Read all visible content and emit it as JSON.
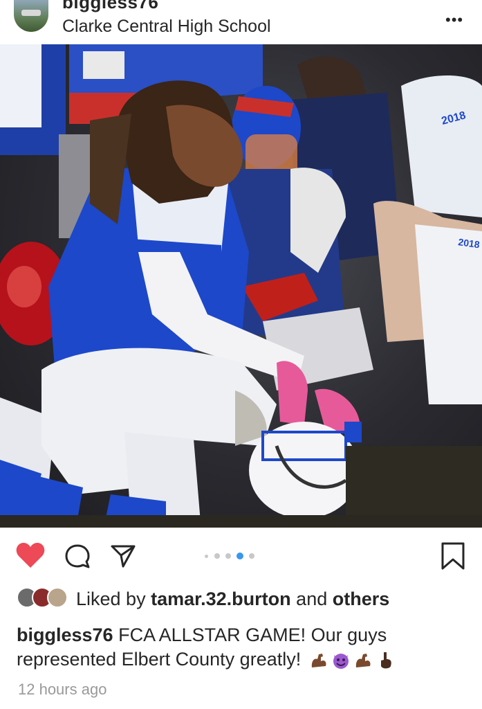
{
  "post": {
    "username": "biggless76",
    "location": "Clarke Central High School"
  },
  "carousel": {
    "count": 5,
    "active_index": 3
  },
  "likes": {
    "prefix": "Liked by",
    "user": "tamar.32.burton",
    "joiner": "and",
    "others": "others"
  },
  "caption": {
    "username": "biggless76",
    "text": "FCA ALLSTAR GAME! Our guys represented Elbert County greatly!",
    "emojis": [
      "flexed-biceps-dark",
      "smiling-devil",
      "flexed-biceps-dark",
      "index-pointing-up-dark"
    ]
  },
  "timestamp": "12 hours ago",
  "photo": {
    "jersey_text": [
      "2018",
      "2018"
    ]
  },
  "colors": {
    "like_red": "#ed4956",
    "text": "#262626",
    "muted": "#999999",
    "carousel_active": "#3897f0",
    "jersey_blue": "#1d48c9"
  },
  "icons": [
    "more-icon",
    "heart-icon",
    "comment-icon",
    "share-icon",
    "bookmark-icon"
  ]
}
